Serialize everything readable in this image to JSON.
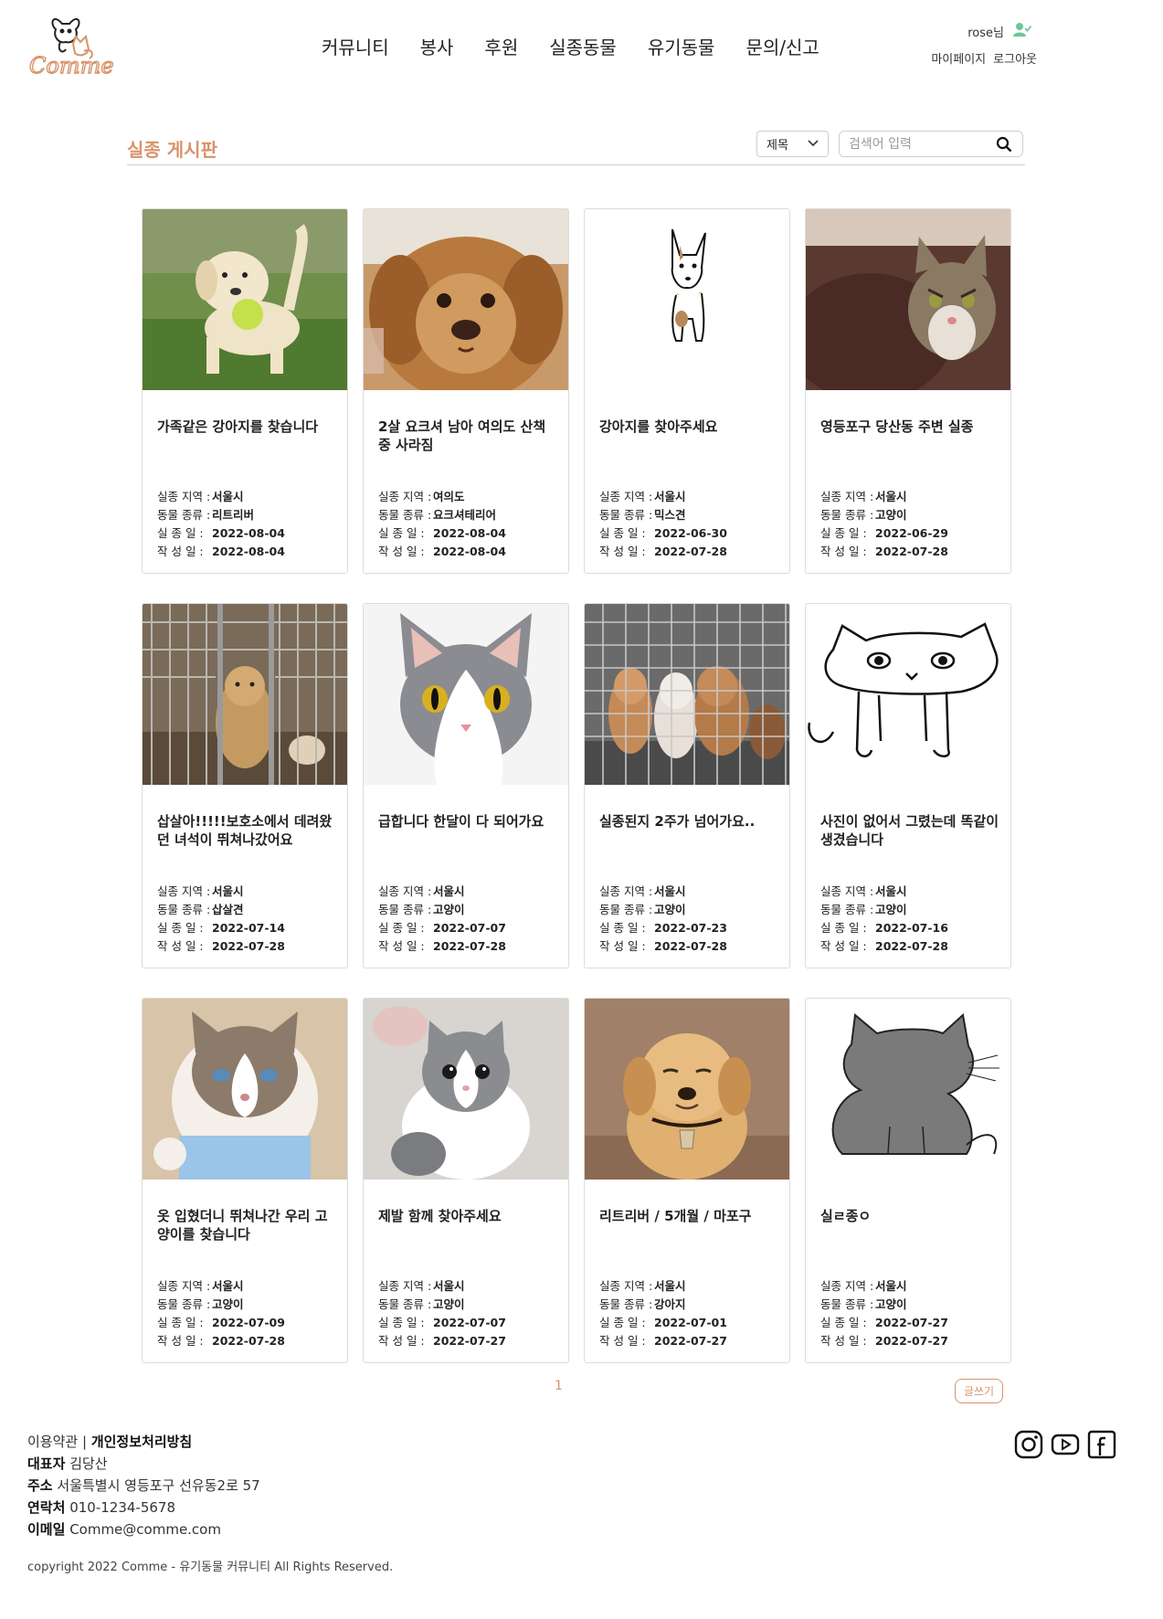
{
  "header": {
    "logo_text": "Comme",
    "nav": [
      "커뮤니티",
      "봉사",
      "후원",
      "실종동물",
      "유기동물",
      "문의/신고"
    ],
    "user_name": "rose님",
    "mypage_label": "마이페이지",
    "logout_label": "로그아웃"
  },
  "board": {
    "title": "실종 게시판",
    "select_value": "제목",
    "search_placeholder": "검색어 입력"
  },
  "labels": {
    "region": "실종 지역 :",
    "species": "동물 종류 :",
    "lost_date": "실 종 일  :",
    "post_date": "작 성 일  :"
  },
  "posts": [
    {
      "title": "가족같은 강아지를 찾습니다",
      "region": "서울시",
      "species": "리트리버",
      "lost_date": "2022-08-04",
      "post_date": "2022-08-04",
      "image": "puppy-with-ball-photo"
    },
    {
      "title": "2살 요크셔 남아 여의도 산책 중 사라짐",
      "region": "여의도",
      "species": "요크셔테리어",
      "lost_date": "2022-08-04",
      "post_date": "2022-08-04",
      "image": "brown-dog-photo"
    },
    {
      "title": "강아지를 찾아주세요",
      "region": "서울시",
      "species": "믹스견",
      "lost_date": "2022-06-30",
      "post_date": "2022-07-28",
      "image": "dog-drawing"
    },
    {
      "title": "영등포구 당산동 주변 실종",
      "region": "서울시",
      "species": "고양이",
      "lost_date": "2022-06-29",
      "post_date": "2022-07-28",
      "image": "tabby-cat-photo"
    },
    {
      "title": "삽살아!!!!!보호소에서 데려왔던 녀석이 뛰쳐나갔어요",
      "region": "서울시",
      "species": "삽살견",
      "lost_date": "2022-07-14",
      "post_date": "2022-07-28",
      "image": "dog-in-cage-photo"
    },
    {
      "title": "급합니다 한달이 다 되어가요",
      "region": "서울시",
      "species": "고양이",
      "lost_date": "2022-07-07",
      "post_date": "2022-07-28",
      "image": "gray-white-cat-photo"
    },
    {
      "title": "실종된지 2주가 넘어가요..",
      "region": "서울시",
      "species": "고양이",
      "lost_date": "2022-07-23",
      "post_date": "2022-07-28",
      "image": "dogs-behind-fence-photo"
    },
    {
      "title": "사진이 없어서 그렸는데 똑같이 생겼습니다",
      "region": "서울시",
      "species": "고양이",
      "lost_date": "2022-07-16",
      "post_date": "2022-07-28",
      "image": "cat-line-drawing"
    },
    {
      "title": "옷 입혔더니 뛰쳐나간 우리 고양이를 찾습니다",
      "region": "서울시",
      "species": "고양이",
      "lost_date": "2022-07-09",
      "post_date": "2022-07-28",
      "image": "ragdoll-cat-photo"
    },
    {
      "title": "제발 함께 찾아주세요",
      "region": "서울시",
      "species": "고양이",
      "lost_date": "2022-07-07",
      "post_date": "2022-07-27",
      "image": "gray-kitten-photo"
    },
    {
      "title": "리트리버 / 5개월 / 마포구",
      "region": "서울시",
      "species": "강아지",
      "lost_date": "2022-07-01",
      "post_date": "2022-07-27",
      "image": "retriever-puppy-photo"
    },
    {
      "title": "실ㄹ종ㅇ",
      "region": "서울시",
      "species": "고양이",
      "lost_date": "2022-07-27",
      "post_date": "2022-07-27",
      "image": "gray-cat-drawing"
    }
  ],
  "pagination": {
    "current": "1"
  },
  "write_label": "글쓰기",
  "footer": {
    "terms": "이용약관",
    "separator": "|",
    "privacy": "개인정보처리방침",
    "ceo_label": "대표자",
    "ceo": "김당산",
    "address_label": "주소",
    "address": "서울특별시 영등포구 선유동2로 57",
    "phone_label": "연락처",
    "phone": "010-1234-5678",
    "email_label": "이메일",
    "email": "Comme@comme.com",
    "copyright": "copyright 2022 Comme - 유기동물 커뮤니티 All Rights Reserved."
  },
  "socials": [
    "instagram-icon",
    "youtube-icon",
    "facebook-icon"
  ],
  "colors": {
    "accent": "#d9936a",
    "user_icon": "#6cc79a"
  }
}
